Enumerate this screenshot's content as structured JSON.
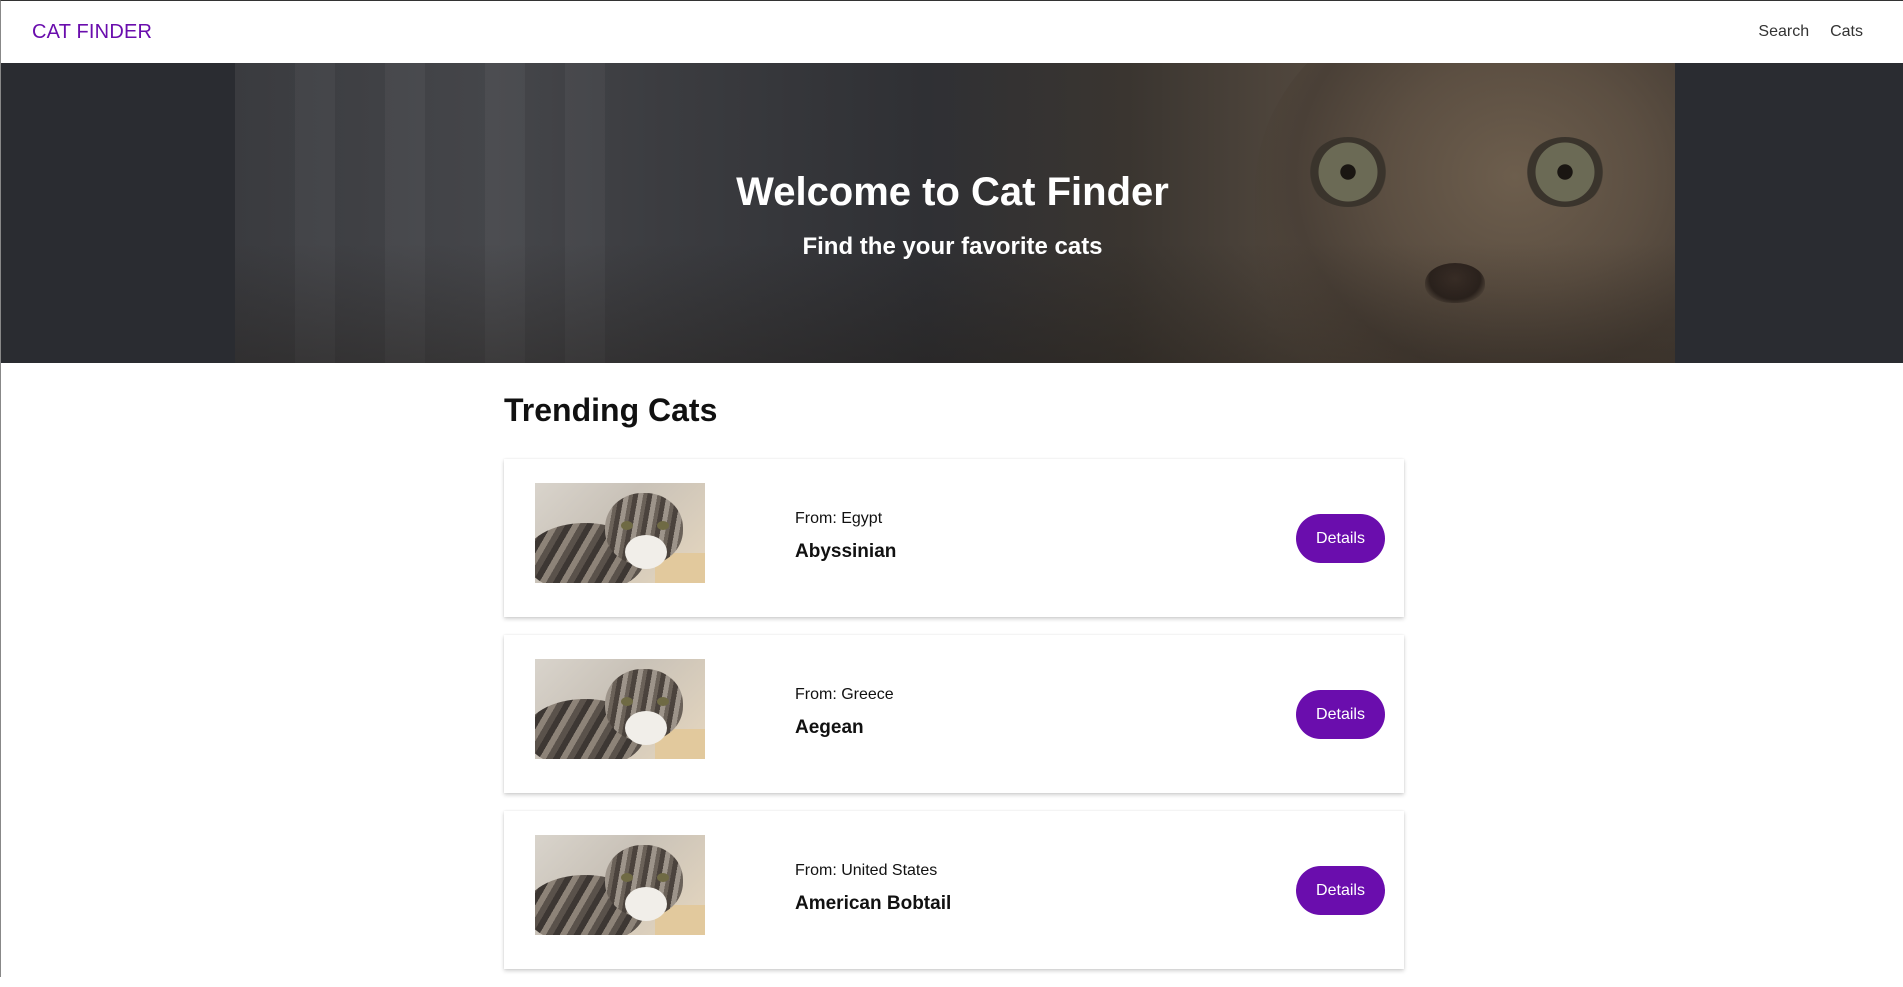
{
  "navbar": {
    "brand": "CAT FINDER",
    "links": [
      "Search",
      "Cats"
    ]
  },
  "hero": {
    "title": "Welcome to Cat Finder",
    "subtitle": "Find the your favorite cats"
  },
  "section": {
    "title": "Trending Cats"
  },
  "cats": [
    {
      "origin": "From: Egypt",
      "name": "Abyssinian",
      "button": "Details"
    },
    {
      "origin": "From: Greece",
      "name": "Aegean",
      "button": "Details"
    },
    {
      "origin": "From: United States",
      "name": "American Bobtail",
      "button": "Details"
    }
  ],
  "colors": {
    "accent": "#6a0dad",
    "hero_background": "#2a2c31"
  }
}
